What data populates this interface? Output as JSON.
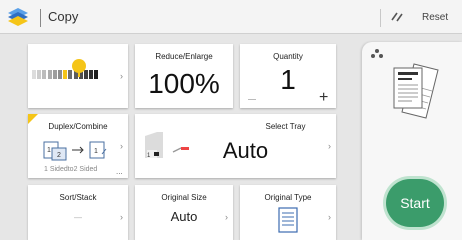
{
  "header": {
    "title": "Copy",
    "reset_label": "Reset",
    "app_icon": "copy-app-icon",
    "reset_icon": "reset-icon"
  },
  "tiles": {
    "density": {
      "level": 7,
      "max": 13
    },
    "reduce_enlarge": {
      "title": "Reduce/Enlarge",
      "value": "100%"
    },
    "quantity": {
      "title": "Quantity",
      "value": "1",
      "minus": "—",
      "plus": "+"
    },
    "duplex": {
      "title": "Duplex/Combine",
      "subtitle": "1 Sidedto2 Sided",
      "more": "..."
    },
    "select_tray": {
      "title": "Select Tray",
      "value": "Auto"
    },
    "sort_stack": {
      "title": "Sort/Stack",
      "value": "—"
    },
    "original_size": {
      "title": "Original Size",
      "value": "Auto"
    },
    "original_type": {
      "title": "Original Type"
    }
  },
  "start_label": "Start",
  "colors": {
    "accent_yellow": "#f5c518",
    "start_green": "#3b9c6b",
    "brand_blue": "#1f5fa8"
  }
}
